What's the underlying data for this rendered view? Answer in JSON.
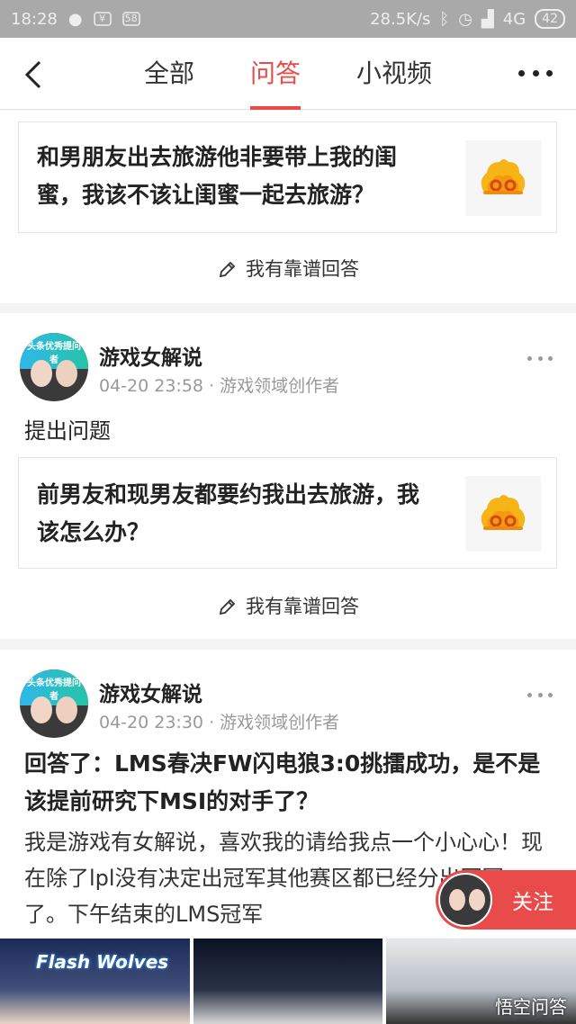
{
  "status_bar": {
    "time": "18:28",
    "app_badge_1": "¥",
    "app_badge_2": "58",
    "speed": "28.5K/s",
    "network": "4G",
    "battery": "42"
  },
  "nav": {
    "tabs": [
      {
        "label": "全部",
        "active": false
      },
      {
        "label": "问答",
        "active": true
      },
      {
        "label": "小视频",
        "active": false
      }
    ]
  },
  "feed": [
    {
      "question": "和男朋友出去旅游他非要带上我的闺蜜，我该不该让闺蜜一起去旅游？",
      "answer_cta": "我有靠谱回答"
    },
    {
      "author": "游戏女解说",
      "avatar_ring_text": "头条优秀提问者",
      "time": "04-20 23:58",
      "role": "游戏领域创作者",
      "action": "提出问题",
      "question": "前男友和现男友都要约我出去旅游，我该怎么办？",
      "answer_cta": "我有靠谱回答"
    },
    {
      "author": "游戏女解说",
      "avatar_ring_text": "头条优秀提问者",
      "time": "04-20 23:30",
      "role": "游戏领域创作者",
      "title": "回答了：LMS春决FW闪电狼3:0挑擂成功，是不是该提前研究下MSI的对手了？",
      "body": "我是游戏有女解说，喜欢我的请给我点一个小心心！现在除了lpl没有决定出冠军其他赛区都已经分出冠军了。下午结束的LMS冠军",
      "thumb_logo": "Flash Wolves",
      "watermark": "悟空问答"
    }
  ],
  "follow_button": {
    "label": "关注"
  },
  "colors": {
    "accent": "#e94b4b",
    "meta": "#999999"
  }
}
